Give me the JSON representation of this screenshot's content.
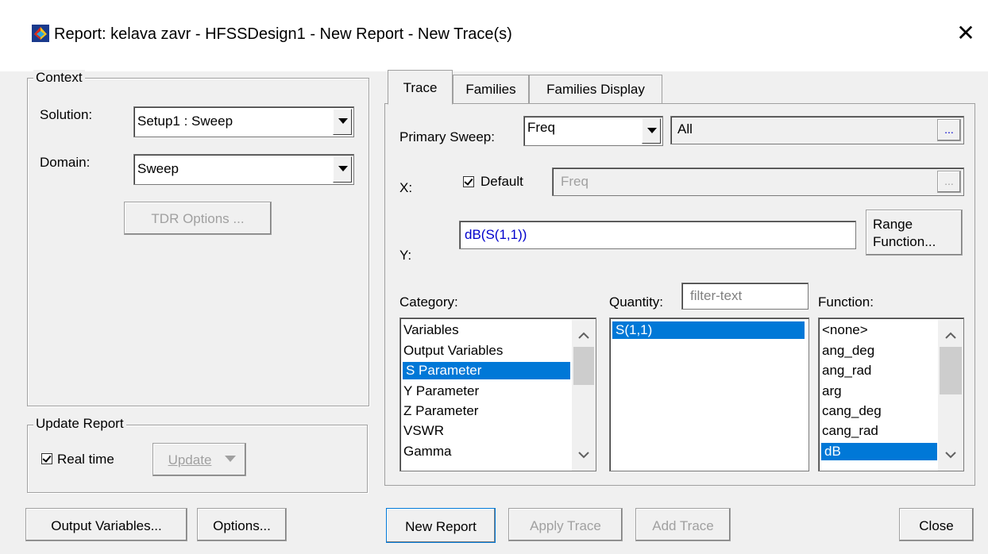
{
  "window": {
    "title": "Report: kelava zavr - HFSSDesign1 - New Report - New Trace(s)",
    "close_glyph": "✕"
  },
  "context": {
    "legend": "Context",
    "solution_label": "Solution:",
    "solution_value": "Setup1 : Sweep",
    "domain_label": "Domain:",
    "domain_value": "Sweep",
    "tdr_button": "TDR Options ..."
  },
  "update_report": {
    "legend": "Update Report",
    "realtime_label": "Real time",
    "realtime_checked": true,
    "update_button": "Update"
  },
  "bottom_left": {
    "output_variables_button": "Output Variables...",
    "options_button": "Options..."
  },
  "tabs": [
    {
      "label": "Trace",
      "active": true
    },
    {
      "label": "Families",
      "active": false
    },
    {
      "label": "Families Display",
      "active": false
    }
  ],
  "trace": {
    "primary_sweep_label": "Primary Sweep:",
    "primary_sweep_value": "Freq",
    "sweep_range_value": "All",
    "ellipsis": "...",
    "x_label": "X:",
    "default_label": "Default",
    "default_checked": true,
    "x_value": "Freq",
    "y_label": "Y:",
    "y_value": "dB(S(1,1))",
    "range_function_line1": "Range",
    "range_function_line2": "Function...",
    "category_label": "Category:",
    "quantity_label": "Quantity:",
    "filter_placeholder": "filter-text",
    "function_label": "Function:",
    "categories": [
      "Variables",
      "Output Variables",
      "S Parameter",
      "Y Parameter",
      "Z Parameter",
      "VSWR",
      "Gamma"
    ],
    "selected_category": "S Parameter",
    "quantities": [
      "S(1,1)"
    ],
    "selected_quantity": "S(1,1)",
    "functions": [
      "<none>",
      "ang_deg",
      "ang_rad",
      "arg",
      "cang_deg",
      "cang_rad",
      "dB"
    ],
    "selected_function": "dB"
  },
  "bottom_right": {
    "new_report_button": "New Report",
    "apply_trace_button": "Apply Trace",
    "add_trace_button": "Add Trace",
    "close_button": "Close"
  },
  "colors": {
    "selection": "#0078d7",
    "expression_text": "#0000cc",
    "dialog_bg": "#f0f0f0"
  }
}
